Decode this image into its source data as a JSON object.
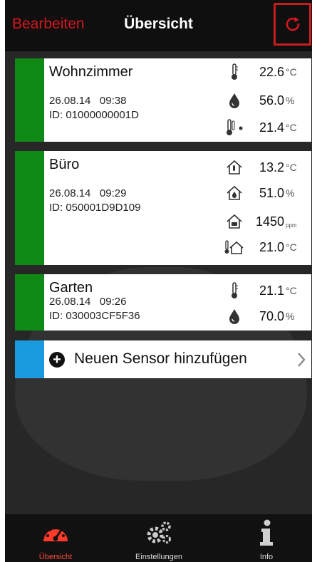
{
  "header": {
    "edit_label": "Bearbeiten",
    "title": "Übersicht",
    "refresh_icon": "refresh-icon"
  },
  "sensors": [
    {
      "name": "Wohnzimmer",
      "date": "26.08.14",
      "time": "09:38",
      "id": "ID: 01000000001D",
      "status_color": "#0f8a14",
      "readings": [
        {
          "icon": "thermometer-icon",
          "value": "22.6",
          "unit": "°C"
        },
        {
          "icon": "humidity-drop-icon",
          "value": "56.0",
          "unit": "%"
        },
        {
          "icon": "dewpoint-thermometer-icon",
          "value": "21.4",
          "unit": "°C"
        }
      ]
    },
    {
      "name": "Büro",
      "date": "26.08.14",
      "time": "09:29",
      "id": "ID: 050001D9D109",
      "status_color": "#0f8a14",
      "readings": [
        {
          "icon": "house-temperature-icon",
          "value": "13.2",
          "unit": "°C"
        },
        {
          "icon": "house-humidity-icon",
          "value": "51.0",
          "unit": "%"
        },
        {
          "icon": "house-co2-icon",
          "value": "1450",
          "unit": "ppm"
        },
        {
          "icon": "outside-temperature-icon",
          "value": "21.0",
          "unit": "°C"
        }
      ]
    },
    {
      "name": "Garten",
      "date": "26.08.14",
      "time": "09:26",
      "id": "ID: 030003CF5F36",
      "status_color": "#0f8a14",
      "readings": [
        {
          "icon": "thermometer-icon",
          "value": "21.1",
          "unit": "°C"
        },
        {
          "icon": "humidity-drop-icon",
          "value": "70.0",
          "unit": "%"
        }
      ]
    }
  ],
  "add_sensor": {
    "label": "Neuen Sensor hinzufügen",
    "accent": "#1a9be0"
  },
  "tabs": [
    {
      "label": "Übersicht",
      "icon": "speedometer-icon",
      "active": true
    },
    {
      "label": "Einstellungen",
      "icon": "gears-icon",
      "active": false
    },
    {
      "label": "Info",
      "icon": "info-icon",
      "active": false
    }
  ],
  "colors": {
    "accent_red": "#d4171e",
    "status_green": "#0f8a14",
    "background": "#272727"
  }
}
